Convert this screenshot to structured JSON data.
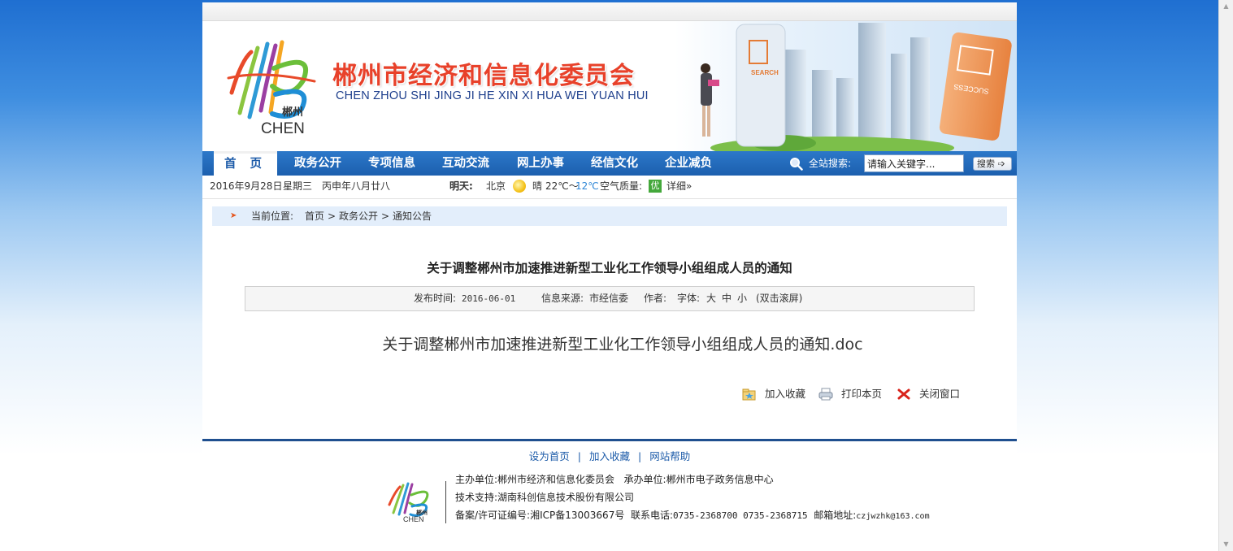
{
  "header": {
    "title": "郴州市经济和信息化委员会",
    "subtitle": "CHEN ZHOU SHI JING JI HE XIN XI HUA WEI YUAN HUI",
    "logo_text": "郴州",
    "logo_sub": "CHEN",
    "banner_word_search": "SEARCH",
    "banner_word_success": "SUCCESS"
  },
  "nav": {
    "items": [
      "首 页",
      "政务公开",
      "专项信息",
      "互动交流",
      "网上办事",
      "经信文化",
      "企业减负"
    ],
    "active_index": 0,
    "search_label": "全站搜索:",
    "search_value": "请输入关键字...",
    "search_button": "搜索"
  },
  "infobar": {
    "date": "2016年9月28日",
    "weekday": "星期三",
    "lunar": "丙申年八月廿八",
    "tomorrow_label": "明天:",
    "city": "北京",
    "weather": "晴",
    "temp_high": "22℃～",
    "temp_low": "12℃",
    "aq_label": "空气质量:",
    "aq_value": "优",
    "detail": "详细»"
  },
  "breadcrumb": {
    "label": "当前位置:",
    "items": [
      "首页",
      "政务公开",
      "通知公告"
    ],
    "separator": ">"
  },
  "article": {
    "title": "关于调整郴州市加速推进新型工业化工作领导小组组成人员的通知",
    "publish_label": "发布时间:",
    "publish_date": "2016-06-01",
    "source_label": "信息来源:",
    "source": "市经信委",
    "author_label": "作者:",
    "font_label": "字体:",
    "font_large": "大",
    "font_medium": "中",
    "font_small": "小",
    "scroll_hint": "(双击滚屏)",
    "attachment": "关于调整郴州市加速推进新型工业化工作领导小组组成人员的通知.doc"
  },
  "actions": {
    "favorite": "加入收藏",
    "print": "打印本页",
    "close": "关闭窗口"
  },
  "footer": {
    "links": [
      "设为首页",
      "加入收藏",
      "网站帮助"
    ],
    "host_label": "主办单位:",
    "host": "郴州市经济和信息化委员会",
    "organizer_label": "承办单位:",
    "organizer": "郴州市电子政务信息中心",
    "tech_label": "技术支持:",
    "tech": "湖南科创信息技术股份有限公司",
    "icp_label": "备案/许可证编号:",
    "icp": "湘ICP备13003667号",
    "phone_label": "联系电话:",
    "phone": "0735-2368700 0735-2368715",
    "email_label": "邮箱地址:",
    "email": "czjwzhk@163.com",
    "logo_text": "郴州",
    "logo_sub": "CHEN"
  },
  "colors": {
    "brand_red": "#e8412a",
    "brand_blue": "#1d3e8c",
    "nav_blue": "#1c5fae",
    "breadcrumb_bg": "#e3eefb",
    "footer_rule": "#1f4f8f"
  }
}
